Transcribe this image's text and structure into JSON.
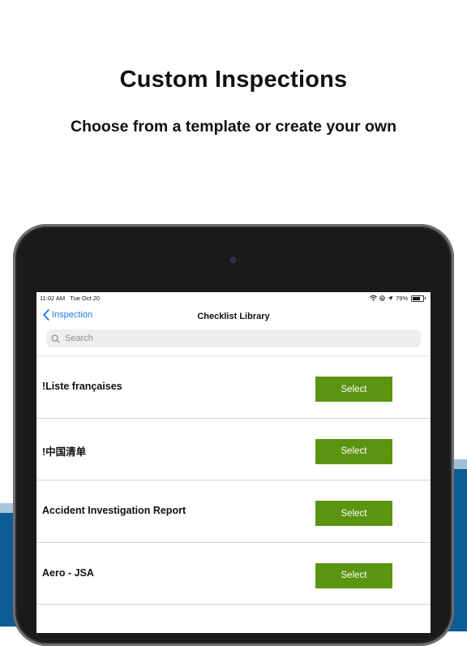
{
  "headline": "Custom Inspections",
  "subheadline": "Choose from a template or create your own",
  "status_bar": {
    "time": "11:02 AM",
    "date": "Tue Oct 20",
    "battery": "79%",
    "icons": [
      "wifi-icon",
      "lock-rotation-icon",
      "location-arrow-icon",
      "battery-icon"
    ]
  },
  "nav": {
    "back_label": "Inspection",
    "title": "Checklist Library"
  },
  "search": {
    "placeholder": "Search"
  },
  "checklists": [
    {
      "name": "!Liste françaises",
      "action": "Select"
    },
    {
      "name": "!中国清单",
      "action": "Select"
    },
    {
      "name": "Accident Investigation Report",
      "action": "Select"
    },
    {
      "name": "Aero - JSA",
      "action": "Select"
    }
  ],
  "colors": {
    "select_button": "#5b9410",
    "link": "#1f7be6",
    "stripe": "#0e5c95"
  }
}
